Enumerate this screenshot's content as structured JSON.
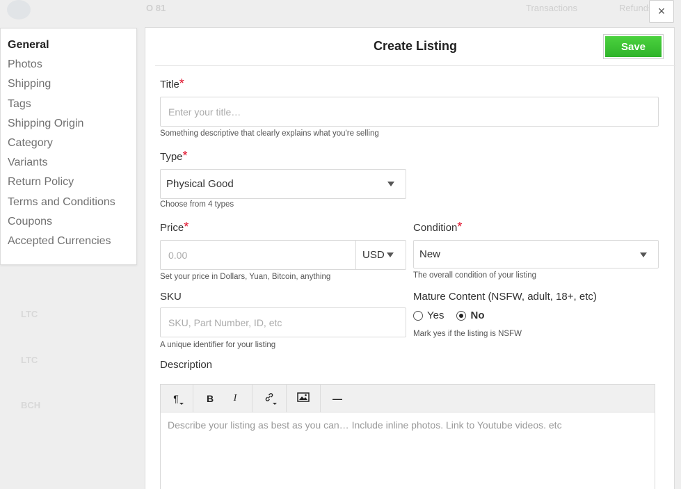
{
  "background": {
    "topbar_text": "O 81",
    "topbar_right_1": "Transactions",
    "topbar_right_2": "Refunds",
    "rows": [
      "LTC",
      "LTC",
      "LTC",
      "BCH"
    ]
  },
  "close_label": "×",
  "nav": {
    "items": [
      "General",
      "Photos",
      "Shipping",
      "Tags",
      "Shipping Origin",
      "Category",
      "Variants",
      "Return Policy",
      "Terms and Conditions",
      "Coupons",
      "Accepted Currencies"
    ],
    "active": "General"
  },
  "header": {
    "title": "Create Listing",
    "save_label": "Save",
    "save_color": "#3cc135"
  },
  "form": {
    "required_mark": "*",
    "title": {
      "label": "Title",
      "placeholder": "Enter your title…",
      "help": "Something descriptive that clearly explains what you're selling"
    },
    "type": {
      "label": "Type",
      "value": "Physical Good",
      "help": "Choose from 4 types"
    },
    "price": {
      "label": "Price",
      "placeholder": "0.00",
      "currency": "USD",
      "help": "Set your price in Dollars, Yuan, Bitcoin, anything"
    },
    "condition": {
      "label": "Condition",
      "value": "New",
      "help": "The overall condition of your listing"
    },
    "sku": {
      "label": "SKU",
      "placeholder": "SKU, Part Number, ID, etc",
      "help": "A unique identifier for your listing"
    },
    "mature": {
      "label": "Mature Content (NSFW, adult, 18+, etc)",
      "yes": "Yes",
      "no": "No",
      "selected": "No",
      "help": "Mark yes if the listing is NSFW"
    },
    "description": {
      "label": "Description",
      "placeholder": "Describe your listing as best as you can… Include inline photos. Link to Youtube videos. etc"
    }
  },
  "toolbar": {
    "paragraph": "¶",
    "bold": "B",
    "italic": "I",
    "rule": "—"
  }
}
